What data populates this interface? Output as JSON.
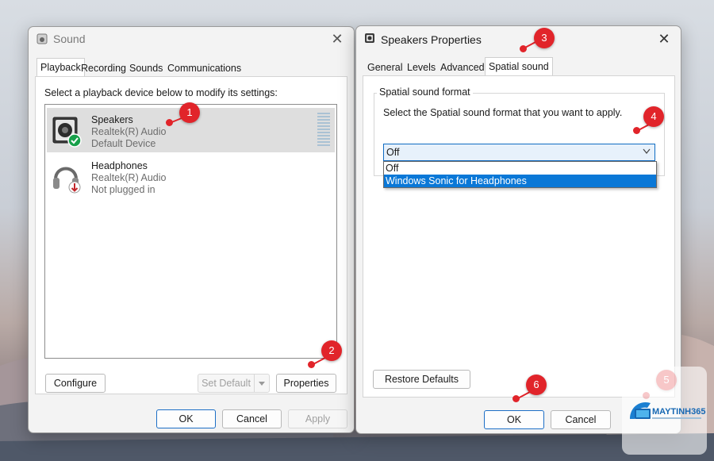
{
  "sound_window": {
    "title": "Sound",
    "close_glyph": "✕",
    "tabs": [
      {
        "label": "Playback",
        "active": true
      },
      {
        "label": "Recording",
        "active": false
      },
      {
        "label": "Sounds",
        "active": false
      },
      {
        "label": "Communications",
        "active": false
      }
    ],
    "instruction": "Select a playback device below to modify its settings:",
    "devices": [
      {
        "name": "Speakers",
        "driver": "Realtek(R) Audio",
        "status": "Default Device",
        "icon": "speaker-icon",
        "badge": "default-check-icon",
        "selected": true
      },
      {
        "name": "Headphones",
        "driver": "Realtek(R) Audio",
        "status": "Not plugged in",
        "icon": "headphones-icon",
        "badge": "unplugged-arrow-icon",
        "selected": false
      }
    ],
    "buttons": {
      "configure": "Configure",
      "set_default": "Set Default",
      "properties": "Properties",
      "ok": "OK",
      "cancel": "Cancel",
      "apply": "Apply"
    }
  },
  "properties_window": {
    "title": "Speakers Properties",
    "close_glyph": "✕",
    "tabs": [
      {
        "label": "General",
        "active": false
      },
      {
        "label": "Levels",
        "active": false
      },
      {
        "label": "Advanced",
        "active": false
      },
      {
        "label": "Spatial sound",
        "active": true
      }
    ],
    "group_title": "Spatial sound format",
    "instruction": "Select the Spatial sound format that you want to apply.",
    "select": {
      "value": "Off",
      "options": [
        "Off",
        "Windows Sonic for Headphones"
      ],
      "highlighted": "Windows Sonic for Headphones"
    },
    "buttons": {
      "restore_defaults": "Restore Defaults",
      "ok": "OK",
      "cancel": "Cancel"
    }
  },
  "markers": [
    "1",
    "2",
    "3",
    "4",
    "5",
    "6"
  ],
  "watermark": {
    "brand": "MAYTINH365"
  },
  "colors": {
    "marker": "#e1242a",
    "accent": "#0f6cc3",
    "highlight": "#0a78d7"
  }
}
